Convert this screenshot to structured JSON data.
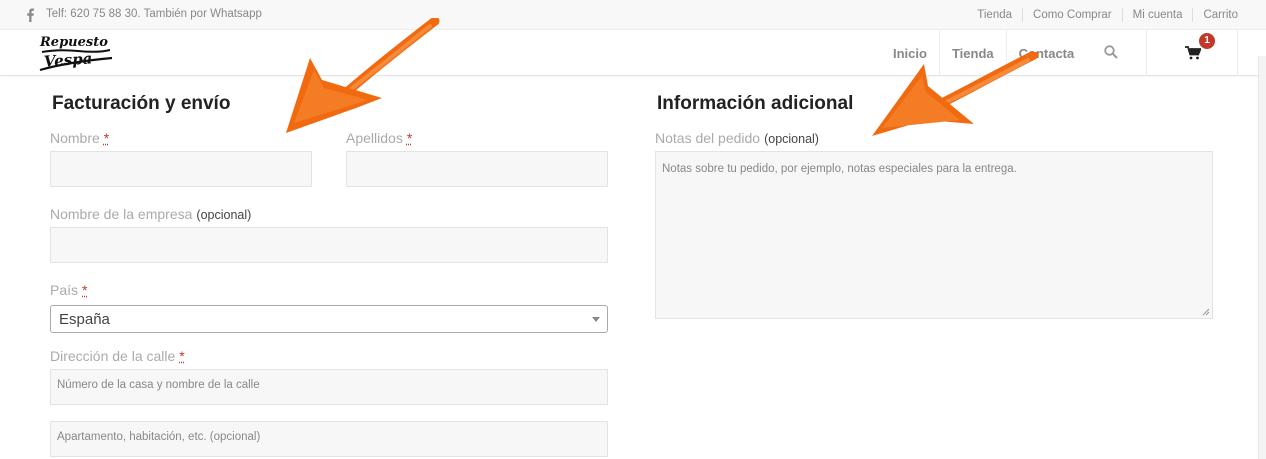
{
  "topbar": {
    "facebook_icon": "facebook-icon",
    "phone_text": "Telf: 620 75 88 30. También por Whatsapp",
    "links": [
      "Tienda",
      "Como Comprar",
      "Mi cuenta",
      "Carrito"
    ]
  },
  "header": {
    "logo_text_top": "Repuesto",
    "logo_text_bottom": "Vespa",
    "nav": [
      "Inicio",
      "Tienda",
      "Contacta"
    ],
    "search_icon": "search-icon",
    "cart_icon": "cart-icon",
    "cart_count": "1"
  },
  "billing": {
    "heading": "Facturación y envío",
    "first_name_label": "Nombre",
    "last_name_label": "Apellidos",
    "company_label": "Nombre de la empresa",
    "optional": "(opcional)",
    "required_mark": "*",
    "country_label": "País",
    "country_value": "España",
    "street_label": "Dirección de la calle",
    "street_placeholder_1": "Número de la casa y nombre de la calle",
    "street_placeholder_2": "Apartamento, habitación, etc. (opcional)"
  },
  "additional": {
    "heading": "Información adicional",
    "notes_label": "Notas del pedido",
    "optional": "(opcional)",
    "notes_placeholder": "Notas sobre tu pedido, por ejemplo, notas especiales para la entrega."
  },
  "colors": {
    "accent": "#c0392b",
    "arrow": "#f26a10"
  }
}
